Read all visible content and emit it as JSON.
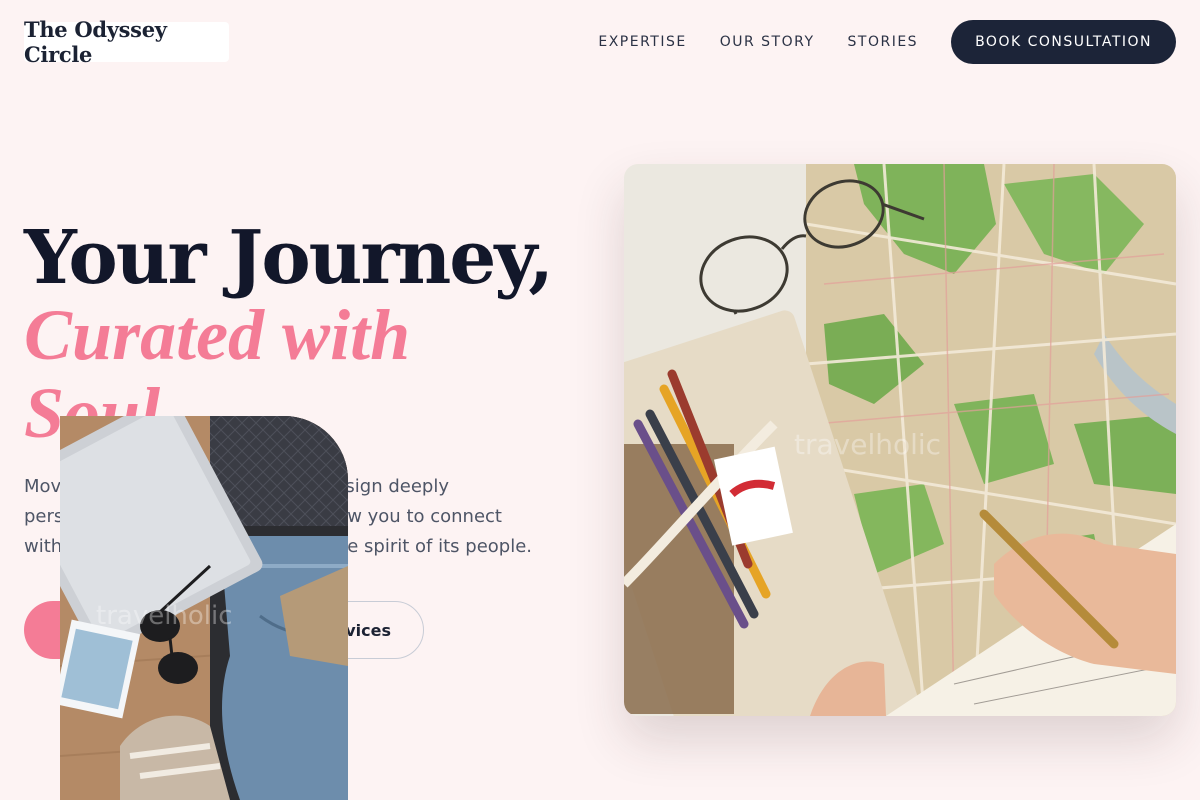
{
  "brand": {
    "name": "The Odyssey Circle"
  },
  "nav": {
    "links": [
      "EXPERTISE",
      "OUR STORY",
      "STORIES"
    ],
    "cta": "BOOK CONSULTATION"
  },
  "hero": {
    "title_line1": "Your Journey,",
    "title_accent": "Curated with Soul",
    "lead_visible_line1_start": "Mov",
    "lead_visible_line1_end": "esign deeply",
    "lead_visible_line2_start": "pers",
    "lead_visible_line2_end": "w you to connect",
    "lead_visible_line3_start": "with",
    "lead_visible_line3_end": "he spirit of its people.",
    "secondary_button_visible": "vices"
  },
  "images": {
    "map_photo_icon": "map-travel-photo",
    "suitcase_photo_icon": "suitcase-travel-photo",
    "watermark": "travelholic"
  },
  "colors": {
    "background": "#fdf3f3",
    "navy": "#1c2438",
    "accent_pink": "#f47c96",
    "body_text": "#4e5566"
  }
}
